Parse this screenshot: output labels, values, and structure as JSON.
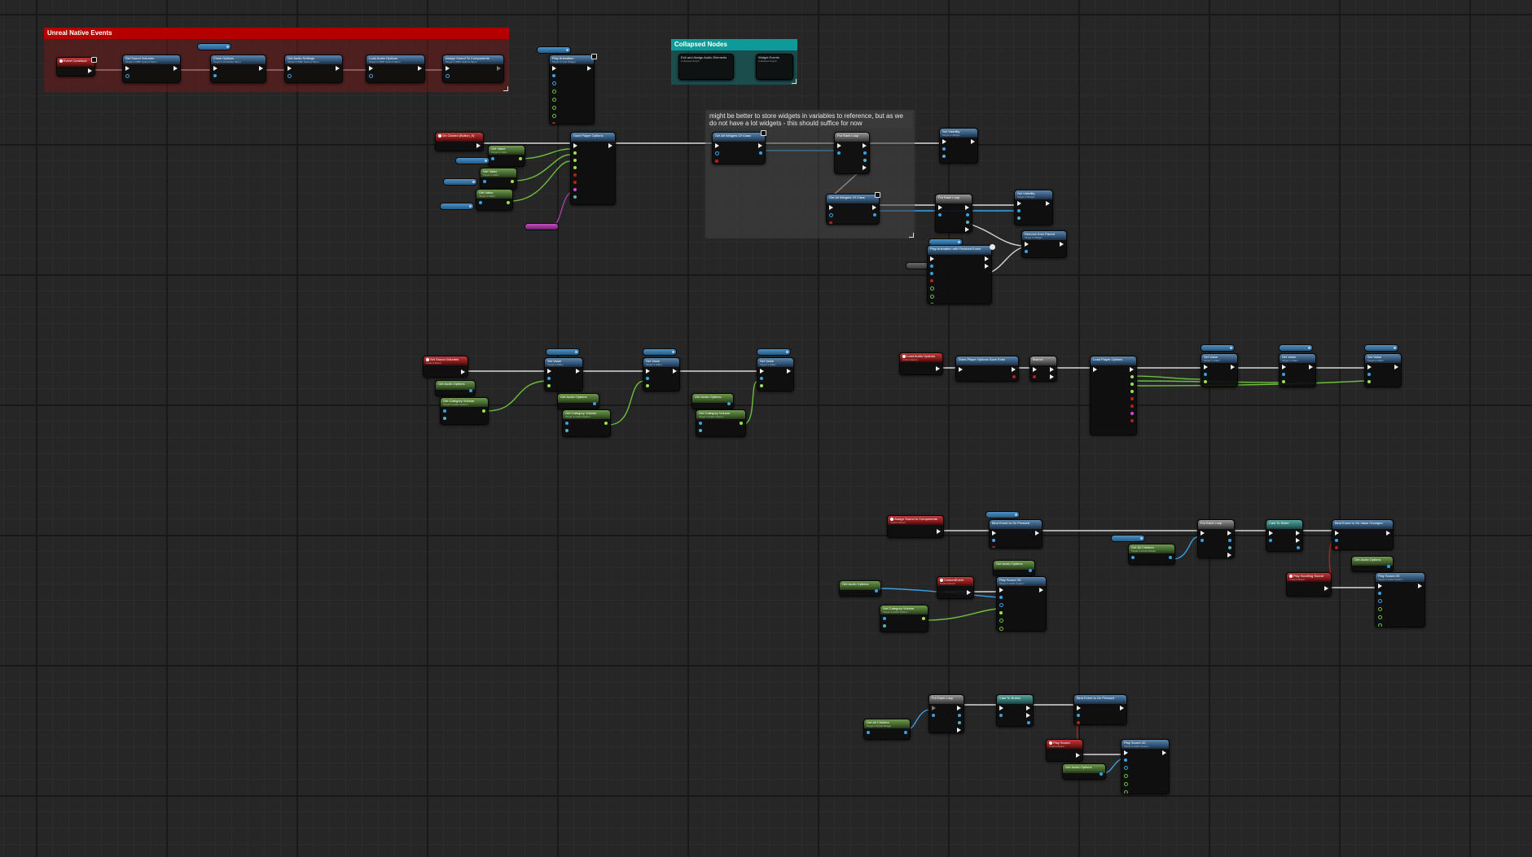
{
  "colors": {
    "event_header": "#7a1414",
    "function_header": "#2a4a6c",
    "pure_header": "#3b5b27",
    "exec_wire": "#e8e8e8",
    "float_wire": "#9be04e",
    "object_wire": "#39a0e5",
    "comment_red": "#b30000",
    "comment_teal": "#0f9a9a",
    "comment_gray": "#3d3d3d"
  },
  "comments": {
    "native_events": "Unreal Native Events",
    "collapsed_nodes": "Collapsed Nodes",
    "widgets_note": "might be better to store widgets in variables to reference, but as we do not have a lot widgets - this should suffice for now"
  },
  "nodes": {
    "event_construct": {
      "title": "Event Construct",
      "subtitle": ""
    },
    "set_sound_volumes": {
      "title": "Set Sound Volumes",
      "subtitle": "Target is WBP Options Menu"
    },
    "close_options": {
      "title": "Close Options",
      "subtitle": "Target is Controller Menu"
    },
    "get_audio_settings_top": {
      "title": "Get Audio Settings",
      "subtitle": "Target is WBP Options Menu"
    },
    "load_audio_options": {
      "title": "Load Audio Options",
      "subtitle": "Target is WBP Options Menu"
    },
    "assign_sound_to_components": {
      "title": "Assign Sound To Components",
      "subtitle": "Target is WBP Options Menu"
    },
    "play_animation_top": {
      "title": "Play Animation",
      "subtitle": "Target is User Widget"
    },
    "on_clicked_button": {
      "title": "On Clicked (Button_0)",
      "subtitle": ""
    },
    "get_value_1": {
      "title": "Get Value",
      "subtitle": "Target is Slider"
    },
    "get_value_2": {
      "title": "Get Value",
      "subtitle": "Target is Slider"
    },
    "get_value_3": {
      "title": "Get Value",
      "subtitle": "Target is Slider"
    },
    "save_player_options": {
      "title": "Save Player Options",
      "subtitle": ""
    },
    "get_all_widgets_1": {
      "title": "Get All Widgets Of Class",
      "subtitle": ""
    },
    "for_each_loop_1": {
      "title": "For Each Loop",
      "subtitle": ""
    },
    "set_visibility_1": {
      "title": "Set Visibility",
      "subtitle": "Target is Widget"
    },
    "get_all_widgets_2": {
      "title": "Get All Widgets Of Class",
      "subtitle": ""
    },
    "for_each_loop_2": {
      "title": "For Each Loop",
      "subtitle": ""
    },
    "set_visibility_2": {
      "title": "Set Visibility",
      "subtitle": "Target is Widget"
    },
    "remove_from_parent": {
      "title": "Remove from Parent",
      "subtitle": "Target is Widget"
    },
    "play_anim_finished": {
      "title": "Play Animation with Finished Event",
      "subtitle": ""
    },
    "set_sound_volumes_event": {
      "title": "Set Sound Volumes",
      "subtitle": "Custom Event"
    },
    "get_audio_options_1": {
      "title": "Get Audio Options",
      "subtitle": ""
    },
    "get_category_volume_1": {
      "title": "Get Category Volume",
      "subtitle": "Target is Audio System"
    },
    "set_value_1": {
      "title": "Set Value",
      "subtitle": "Target is Slider"
    },
    "get_audio_options_2": {
      "title": "Get Audio Options",
      "subtitle": ""
    },
    "get_category_volume_2": {
      "title": "Get Category Volume",
      "subtitle": "Target is Audio System"
    },
    "set_value_2": {
      "title": "Set Value",
      "subtitle": "Target is Slider"
    },
    "get_audio_options_3": {
      "title": "Get Audio Options",
      "subtitle": ""
    },
    "get_category_volume_3": {
      "title": "Get Category Volume",
      "subtitle": "Target is Audio System"
    },
    "set_value_3": {
      "title": "Set Value",
      "subtitle": "Target is Slider"
    },
    "load_audio_options_event": {
      "title": "Load Audio Options",
      "subtitle": "Custom Event"
    },
    "does_save_exist": {
      "title": "Does Player Options Save Exist",
      "subtitle": ""
    },
    "branch": {
      "title": "Branch",
      "subtitle": ""
    },
    "load_player_options": {
      "title": "Load Player Options",
      "subtitle": ""
    },
    "set_value_4": {
      "title": "Set Value",
      "subtitle": "Target is Slider"
    },
    "set_value_5": {
      "title": "Set Value",
      "subtitle": "Target is Slider"
    },
    "set_value_6": {
      "title": "Set Value",
      "subtitle": "Target is Slider"
    },
    "assign_sound_event": {
      "title": "Assign Sound to Components",
      "subtitle": "Custom Event"
    },
    "bind_event_on_pressed_1": {
      "title": "Bind Event to On Pressed",
      "subtitle": ""
    },
    "custom_event": {
      "title": "CustomEvent",
      "subtitle": "Custom Event"
    },
    "get_audio_options_4": {
      "title": "Get Audio Options",
      "subtitle": ""
    },
    "get_audio_options_5": {
      "title": "Get Audio Options",
      "subtitle": ""
    },
    "get_category_volume_4": {
      "title": "Get Category Volume",
      "subtitle": "Target is Audio System"
    },
    "play_sound_2d_1": {
      "title": "Play Sound 2D",
      "subtitle": "Target is Audio System"
    },
    "for_each_loop_3": {
      "title": "For Each Loop",
      "subtitle": ""
    },
    "get_all_children": {
      "title": "Get All Children",
      "subtitle": "Target is Panel Widget"
    },
    "cast_to_slider": {
      "title": "Cast To Slider",
      "subtitle": ""
    },
    "bind_on_value_changed": {
      "title": "Bind Event to On Value Changed",
      "subtitle": ""
    },
    "play_scrolling_sound": {
      "title": "Play Scrolling Sound",
      "subtitle": "Custom Event"
    },
    "get_audio_options_6": {
      "title": "Get Audio Options",
      "subtitle": ""
    },
    "play_sound_2d_2": {
      "title": "Play Sound 2D",
      "subtitle": "Target is Audio System"
    },
    "for_each_loop_4": {
      "title": "For Each Loop",
      "subtitle": ""
    },
    "get_all_children_2": {
      "title": "Get All Children",
      "subtitle": "Target is Panel Widget"
    },
    "cast_to_button": {
      "title": "Cast To Button",
      "subtitle": ""
    },
    "bind_event_on_pressed_2": {
      "title": "Bind Event to On Pressed",
      "subtitle": ""
    },
    "play_sound": {
      "title": "Play Sound",
      "subtitle": "Custom Event"
    },
    "get_audio_options_7": {
      "title": "Get Audio Options",
      "subtitle": ""
    },
    "play_sound_2d_3": {
      "title": "Play Sound 2D",
      "subtitle": "Target is Audio System"
    }
  },
  "collapsed": {
    "exit_assign": {
      "title": "Exit and Assign Audio Elements",
      "subtitle": "Collapsed Graph"
    },
    "widget_events": {
      "title": "Widget Events",
      "subtitle": "Collapsed Graph"
    }
  }
}
